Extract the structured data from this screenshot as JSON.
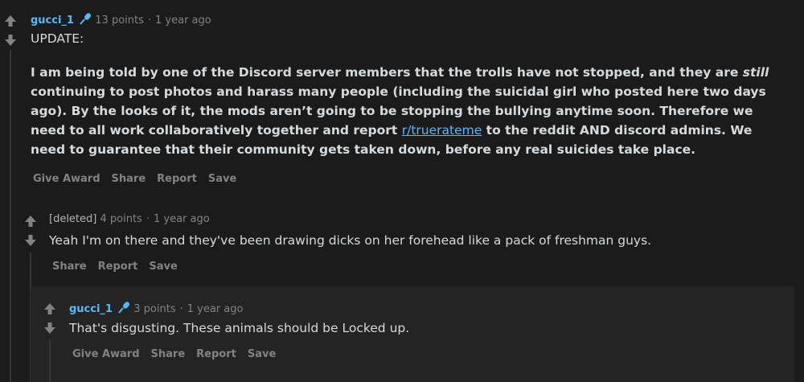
{
  "comment1": {
    "author": "gucci_1",
    "points": "13 points",
    "time": "1 year ago",
    "update": "UPDATE:",
    "p1": "I am being told by one of the Discord server members that the trolls have not stopped, and they are ",
    "p1_em": "still",
    "p1_rest": " continuing to post photos and harass many people (including the suicidal girl who posted here two days ago). By the looks of it, the mods aren’t going to be stopping the bullying anytime soon. Therefore we need to all work collaboratively together and report ",
    "link": "r/truerateme",
    "p1_end": " to the reddit AND discord admins. We need to guarantee that their community gets taken down, before any real suicides take place.",
    "actions": [
      "Give Award",
      "Share",
      "Report",
      "Save"
    ]
  },
  "comment2": {
    "author": "[deleted]",
    "points": "4 points",
    "time": "1 year ago",
    "text": "Yeah I'm on there and they've been drawing dicks on her forehead like a pack of freshman guys.",
    "actions": [
      "Share",
      "Report",
      "Save"
    ]
  },
  "comment3": {
    "author": "gucci_1",
    "points": "3 points",
    "time": "1 year ago",
    "text": "That's disgusting. These animals should be Locked up.",
    "actions": [
      "Give Award",
      "Share",
      "Report",
      "Save"
    ]
  },
  "colors": {
    "background": "#1b1b1b",
    "nested_background": "#242424",
    "author": "#4fbcff",
    "link": "#4fbcff",
    "meta": "#818384",
    "text": "#d7dadc"
  }
}
